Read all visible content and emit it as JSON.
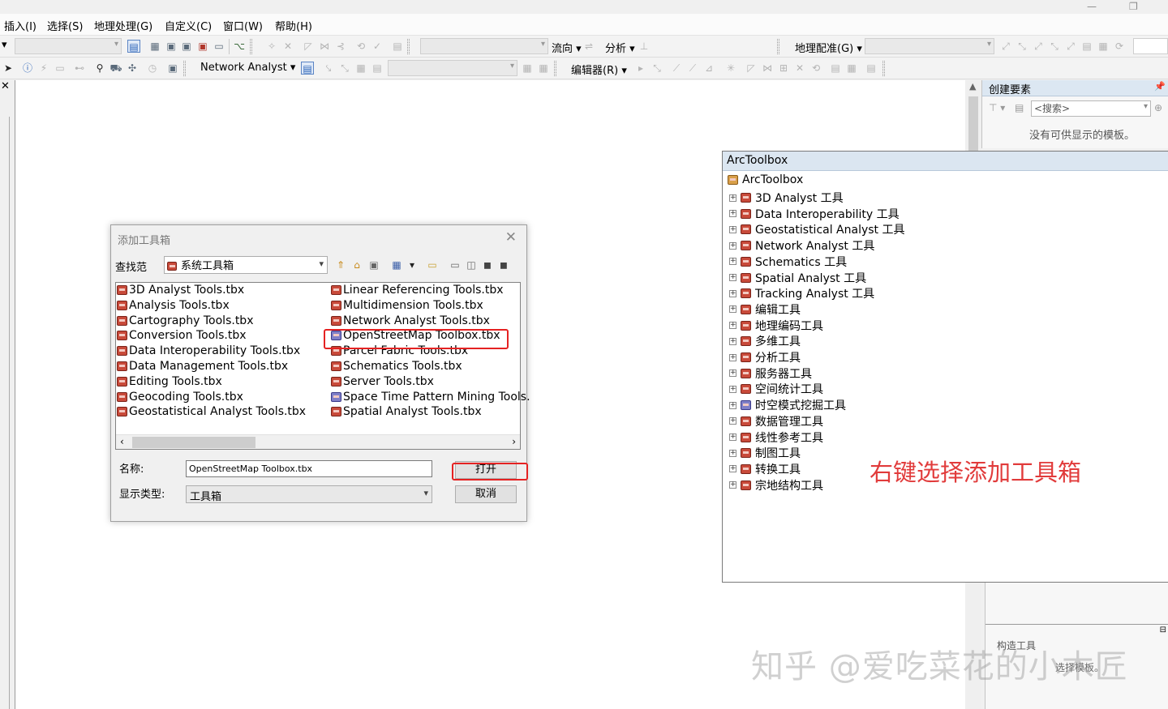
{
  "menubar": {
    "items": [
      "插入(I)",
      "选择(S)",
      "地理处理(G)",
      "自定义(C)",
      "窗口(W)",
      "帮助(H)"
    ]
  },
  "toolbar1": {
    "flow_direction": "流向",
    "analysis": "分析",
    "georef": "地理配准(G)"
  },
  "toolbar2": {
    "network_analyst": "Network Analyst",
    "editor": "编辑器(R)"
  },
  "icons": {
    "pointer": "pointer-icon",
    "identify": "identify-icon",
    "find": "binoculars-icon",
    "toolbox": "toolbox-icon",
    "search": "search-icon",
    "pin": "pin-icon"
  },
  "create_features": {
    "title": "创建要素",
    "search_placeholder": "<搜索>",
    "empty_message": "没有可供显示的模板。"
  },
  "lower_panel": {
    "title": "构造工具",
    "hint": "选择模板。"
  },
  "arctoolbox": {
    "title": "ArcToolbox",
    "root": "ArcToolbox",
    "items": [
      "3D Analyst 工具",
      "Data Interoperability 工具",
      "Geostatistical Analyst 工具",
      "Network Analyst 工具",
      "Schematics 工具",
      "Spatial Analyst 工具",
      "Tracking Analyst 工具",
      "编辑工具",
      "地理编码工具",
      "多维工具",
      "分析工具",
      "服务器工具",
      "空间统计工具",
      "时空模式挖掘工具",
      "数据管理工具",
      "线性参考工具",
      "制图工具",
      "转换工具",
      "宗地结构工具"
    ]
  },
  "annotation": "右键选择添加工具箱",
  "dialog": {
    "title": "添加工具箱",
    "look_in_label": "查找范",
    "look_in_value": "系统工具箱",
    "files_col1": [
      "3D Analyst Tools.tbx",
      "Analysis Tools.tbx",
      "Cartography Tools.tbx",
      "Conversion Tools.tbx",
      "Data Interoperability Tools.tbx",
      "Data Management Tools.tbx",
      "Editing Tools.tbx",
      "Geocoding Tools.tbx",
      "Geostatistical Analyst Tools.tbx"
    ],
    "files_col2": [
      "Linear Referencing Tools.tbx",
      "Multidimension Tools.tbx",
      "Network Analyst Tools.tbx",
      "OpenStreetMap Toolbox.tbx",
      "Parcel Fabric Tools.tbx",
      "Schematics Tools.tbx",
      "Server Tools.tbx",
      "Space Time Pattern Mining Tools.",
      "Spatial Analyst Tools.tbx"
    ],
    "name_label": "名称:",
    "name_value": "OpenStreetMap Toolbox.tbx",
    "type_label": "显示类型:",
    "type_value": "工具箱",
    "open_button": "打开",
    "cancel_button": "取消"
  },
  "watermark": "知乎 @爱吃菜花的小木匠",
  "colors": {
    "accent_red": "#e52222",
    "annotation_red": "#e13b3b",
    "panel_title_bg": "#dbe6f1",
    "toolbox_icon": "#c84a3a"
  }
}
